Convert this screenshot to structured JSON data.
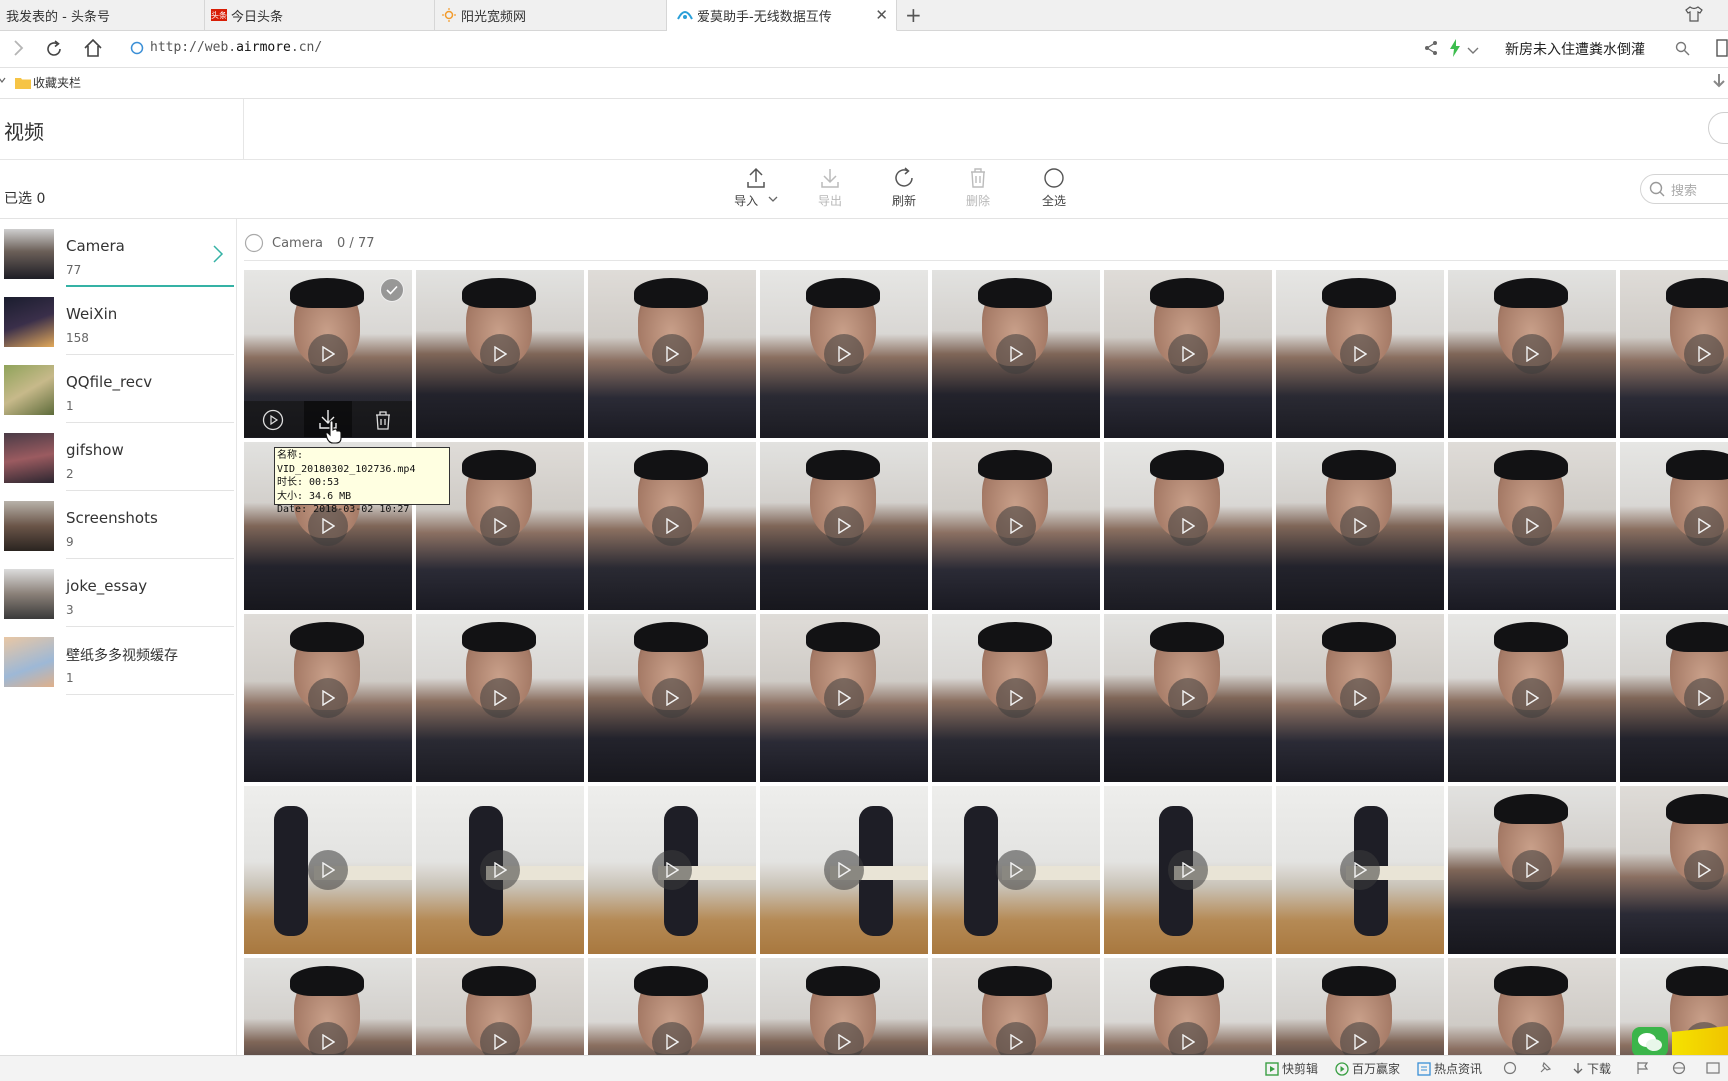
{
  "browser": {
    "tabs": [
      {
        "label": "我发表的 - 头条号",
        "icon": "none"
      },
      {
        "label": "今日头条",
        "icon": "toutiao-logo-icon",
        "icon_text": "头条"
      },
      {
        "label": "阳光宽频网",
        "icon": "sun-logo-icon"
      },
      {
        "label": "爱莫助手-无线数据互传",
        "icon": "airmore-logo-icon"
      }
    ],
    "new_tab_label": "+",
    "url_scheme": "http://web.",
    "url_host": "airmore",
    "url_rest": ".cn/",
    "search_text": "新房未入住遭粪水倒灌",
    "bookmarks_label": "收藏夹栏"
  },
  "app": {
    "section_title": "视频",
    "selected_label": "已选 0",
    "toolbar": {
      "import": "导入",
      "export": "导出",
      "refresh": "刷新",
      "delete": "删除",
      "select_all": "全选"
    },
    "search_placeholder": "搜索",
    "albums": [
      {
        "name": "Camera",
        "count": "77"
      },
      {
        "name": "WeiXin",
        "count": "158"
      },
      {
        "name": "QQfile_recv",
        "count": "1"
      },
      {
        "name": "gifshow",
        "count": "2"
      },
      {
        "name": "Screenshots",
        "count": "9"
      },
      {
        "name": "joke_essay",
        "count": "3"
      },
      {
        "name": "壁纸多多视频缓存",
        "count": "1"
      }
    ],
    "album_header": {
      "name": "Camera",
      "progress": "0 / 77"
    },
    "tooltip": {
      "name_line": "名称: VID_20180302_102736.mp4",
      "duration_line": "时长: 00:53",
      "size_line": "大小: 34.6 MB",
      "date_line": "Date: 2018-03-02 10:27"
    }
  },
  "statusbar": {
    "items": [
      "快剪辑",
      "百万赢家",
      "热点资讯",
      "下载"
    ]
  },
  "colors": {
    "accent": "#35b2a5",
    "tooltip_bg": "#ffffe1"
  }
}
